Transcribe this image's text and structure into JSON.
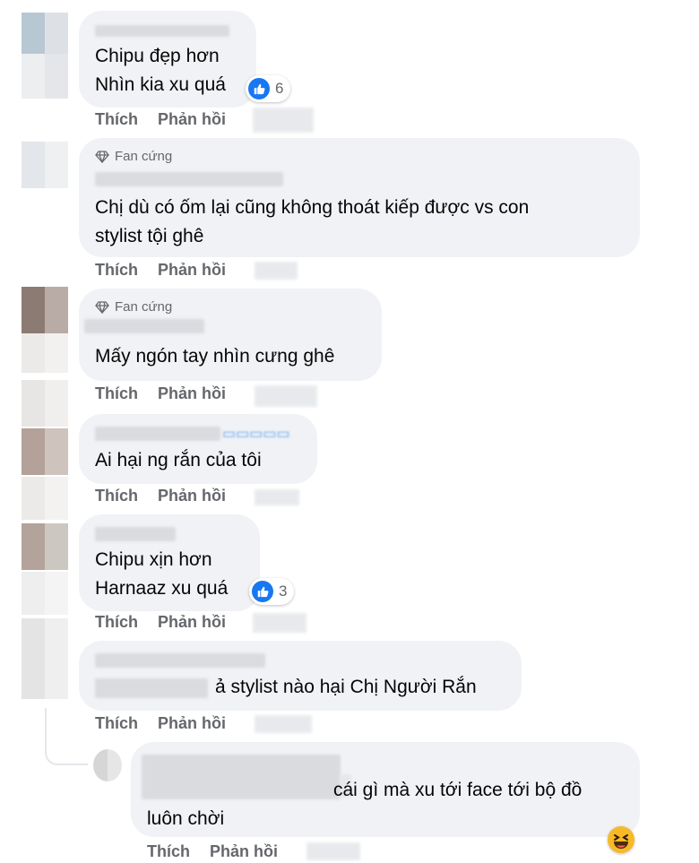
{
  "labels": {
    "like": "Thích",
    "reply": "Phản hồi",
    "fan_badge": "Fan cứng"
  },
  "comments": [
    {
      "lines": [
        "Chipu đẹp hơn",
        "Nhìn kia xu quá"
      ],
      "reaction_count": "6"
    },
    {
      "badge": true,
      "lines": [
        "Chị dù có ốm lại cũng không thoát kiếp được vs con",
        "stylist tội ghê"
      ]
    },
    {
      "badge": true,
      "lines": [
        "Mấy ngón tay nhìn cưng ghê"
      ]
    },
    {
      "lines": [
        "Ai hại ng rắn của tôi"
      ]
    },
    {
      "lines": [
        "Chipu xịn hơn",
        "Harnaaz xu quá"
      ],
      "reaction_count": "3"
    },
    {
      "lines": [
        "ả stylist nào hại Chị Người Rắn"
      ]
    },
    {
      "lines": [
        "cái gì mà xu tới face tới bộ đồ",
        "luôn chời"
      ]
    }
  ],
  "colors": {
    "bubble": "#f0f2f5",
    "meta": "#65676b",
    "like_blue": "#1877f2",
    "haha_yellow": "#f7b928"
  },
  "icons": {
    "badge": "diamond-icon",
    "reaction": "like-icon",
    "reaction_haha": "haha-icon"
  }
}
